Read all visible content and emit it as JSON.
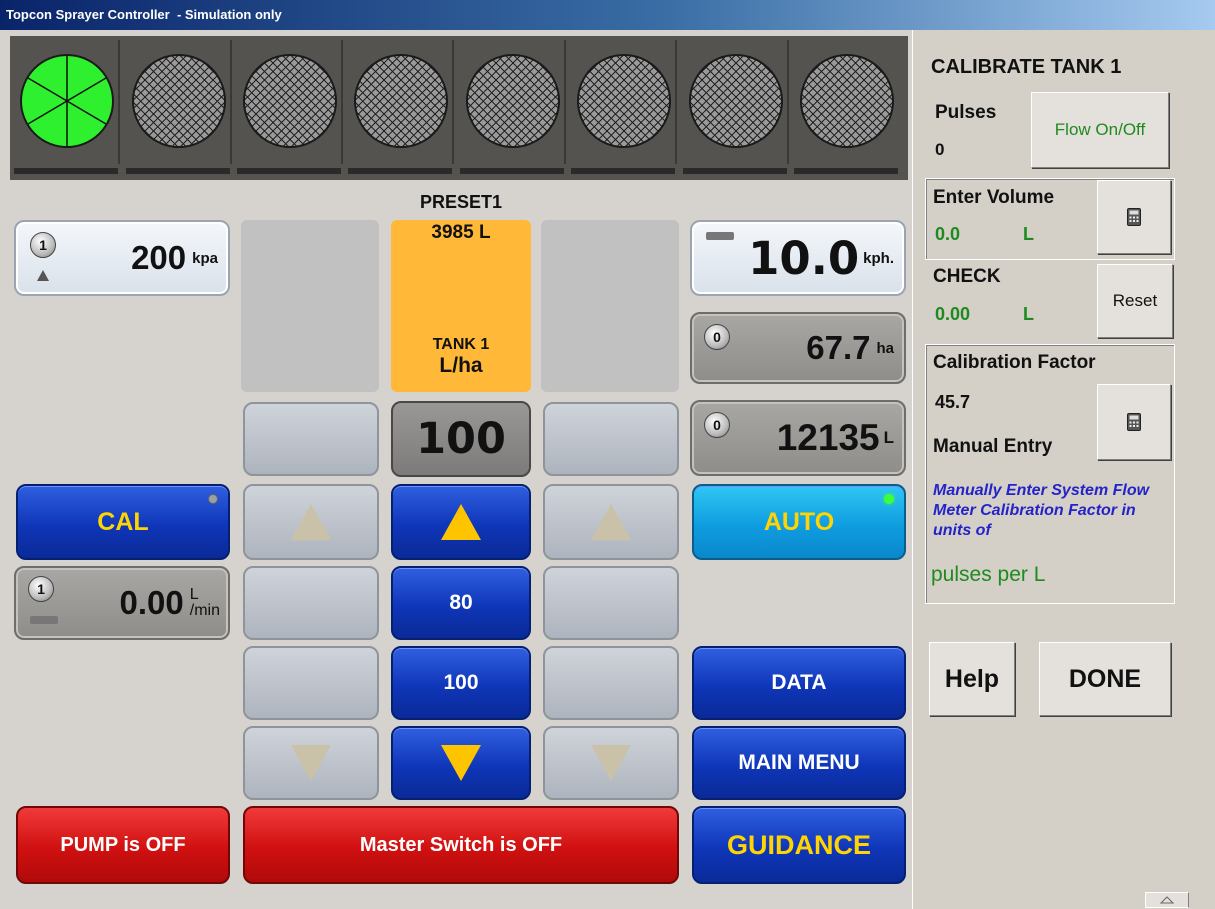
{
  "window": {
    "title": "Topcon Sprayer Controller  - Simulation only"
  },
  "sections": {
    "on": [
      true,
      false,
      false,
      false,
      false,
      false,
      false,
      false
    ]
  },
  "pressure": {
    "knob": "1",
    "value": "200",
    "unit": "kpa"
  },
  "speed": {
    "value": "10.0",
    "unit": "kph."
  },
  "area": {
    "knob": "0",
    "value": "67.7",
    "unit": "ha"
  },
  "volume": {
    "knob": "0",
    "value": "12135",
    "unit": "L"
  },
  "flow": {
    "knob": "1",
    "value": "0.00",
    "unit_top": "L",
    "unit_bottom": "/min"
  },
  "tank": {
    "preset": "PRESET1",
    "volume": "3985 L",
    "name": "TANK 1",
    "rate_unit": "L/ha"
  },
  "rate": {
    "target": "100",
    "preset_a": "80",
    "preset_b": "100"
  },
  "buttons": {
    "cal": "CAL",
    "auto": "AUTO",
    "data": "DATA",
    "main_menu": "MAIN MENU",
    "guidance": "GUIDANCE",
    "pump": "PUMP is OFF",
    "master": "Master Switch is OFF"
  },
  "panel": {
    "heading": "CALIBRATE TANK 1",
    "pulses_label": "Pulses",
    "pulses_value": "0",
    "flow_button": "Flow On/Off",
    "enter_volume_label": "Enter Volume",
    "enter_volume_value": "0.0",
    "enter_volume_unit": "L",
    "check_label": "CHECK",
    "check_value": "0.00",
    "check_unit": "L",
    "reset_button": "Reset",
    "cal_factor_label": "Calibration Factor",
    "cal_factor_value": "45.7",
    "manual_entry_label": "Manual Entry",
    "hint": "Manually Enter System Flow Meter Calibration Factor in units of",
    "hint_units": "pulses per L",
    "help_button": "Help",
    "done_button": "DONE"
  },
  "icons": {
    "calculator": "calculator-icon",
    "scroll": "scroll-up-icon"
  },
  "colors": {
    "section_on": "#2ef02e",
    "tank": "#ffb838",
    "button_blue": "#0f36b8",
    "button_red": "#d01010",
    "hint_blue": "#2323c8",
    "value_green": "#1f8a1f"
  }
}
